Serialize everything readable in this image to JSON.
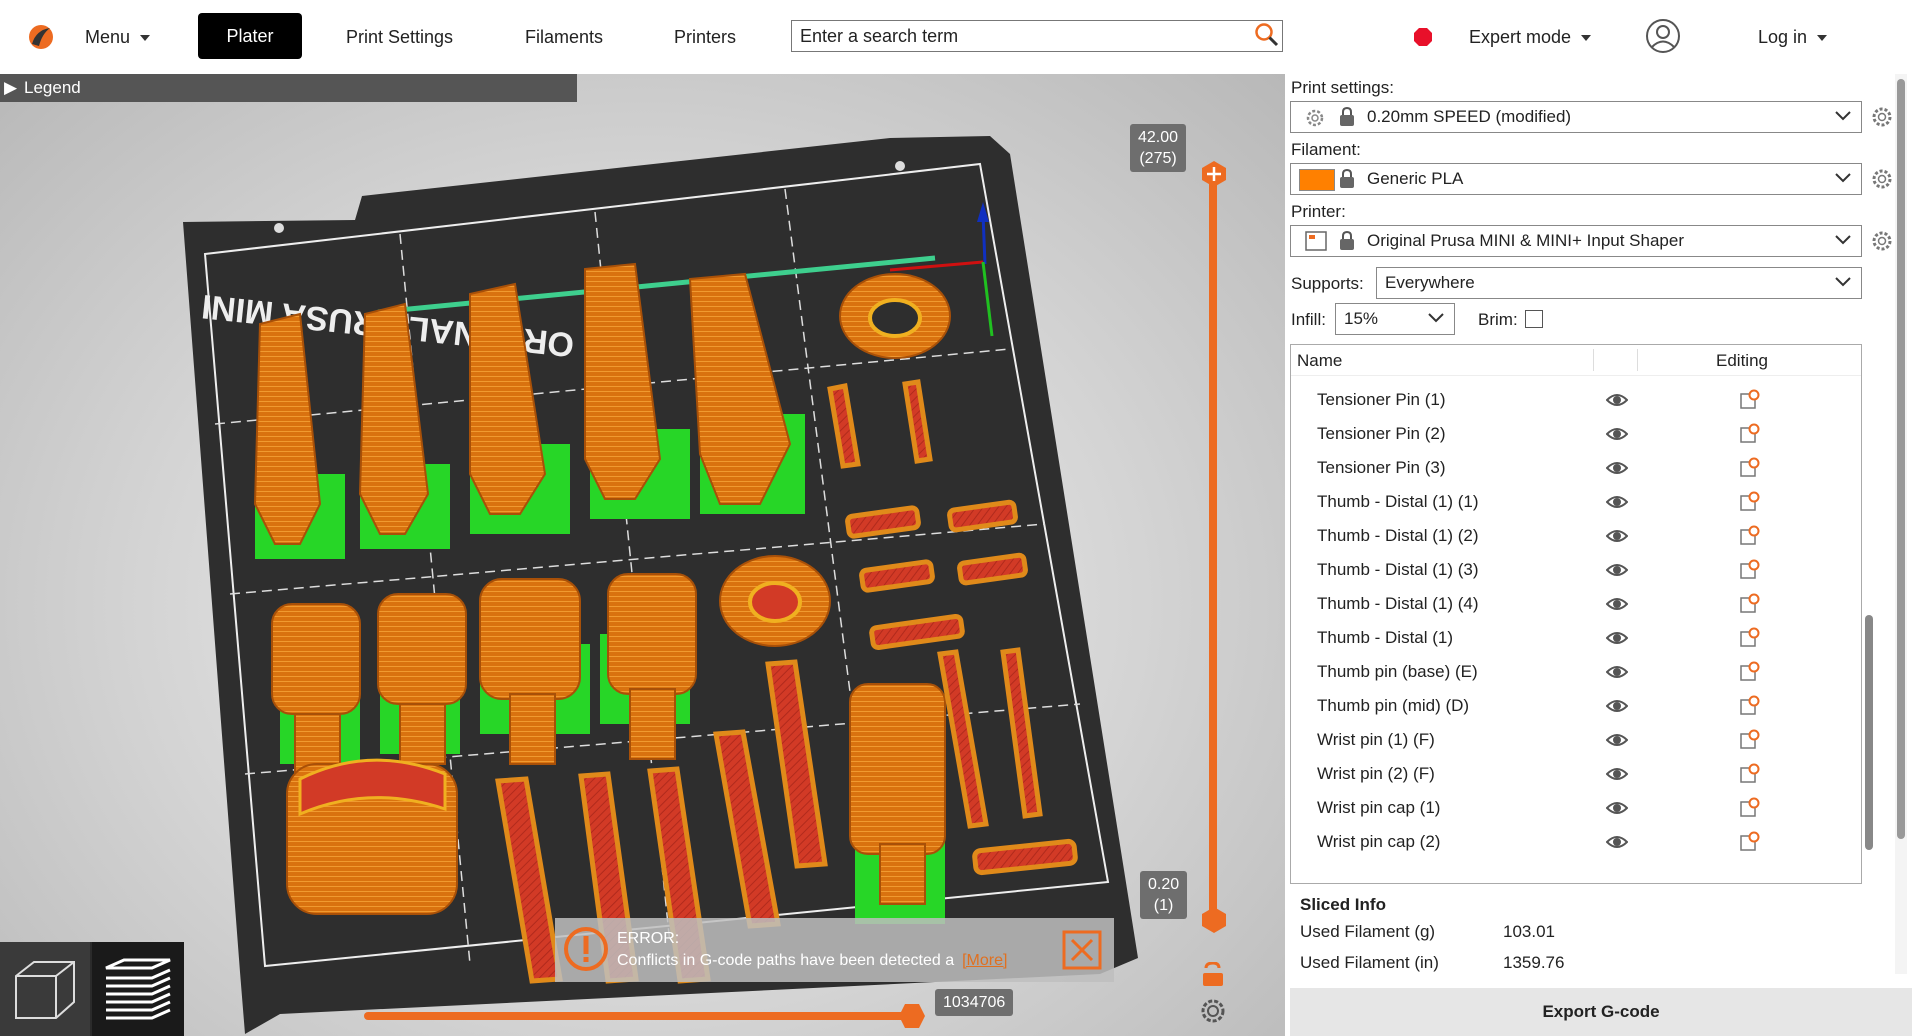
{
  "topbar": {
    "menu_label": "Menu",
    "tabs": [
      "Plater",
      "Print Settings",
      "Filaments",
      "Printers"
    ],
    "search_placeholder": "Enter a search term",
    "mode_label": "Expert mode",
    "login_label": "Log in"
  },
  "viewport": {
    "legend_label": "Legend",
    "layer_top": "42.00",
    "layer_top_index": "(275)",
    "layer_bottom": "0.20",
    "layer_bottom_index": "(1)",
    "move_value": "1034706",
    "bed_text": "ORIGINAL PRUSA MINI",
    "error_title": "ERROR:",
    "error_message": "Conflicts in G-code paths have been detected a",
    "error_more": "[More]"
  },
  "sidebar": {
    "print_settings_label": "Print settings:",
    "print_settings_value": "0.20mm SPEED (modified)",
    "filament_label": "Filament:",
    "filament_value": "Generic PLA",
    "filament_color": "#ff8000",
    "printer_label": "Printer:",
    "printer_value": "Original Prusa MINI & MINI+ Input Shaper",
    "supports_label": "Supports:",
    "supports_value": "Everywhere",
    "infill_label": "Infill:",
    "infill_value": "15%",
    "brim_label": "Brim:",
    "brim_checked": false,
    "list_header_name": "Name",
    "list_header_editing": "Editing",
    "objects": [
      "Tensioner Pin (1)",
      "Tensioner Pin (2)",
      "Tensioner Pin (3)",
      "Thumb - Distal (1) (1)",
      "Thumb - Distal (1) (2)",
      "Thumb - Distal (1) (3)",
      "Thumb - Distal (1) (4)",
      "Thumb - Distal (1)",
      "Thumb pin (base) (E)",
      "Thumb pin (mid) (D)",
      "Wrist pin (1) (F)",
      "Wrist pin (2) (F)",
      "Wrist pin cap (1)",
      "Wrist pin cap (2)"
    ],
    "sliced_info_title": "Sliced Info",
    "used_filament_g_label": "Used Filament (g)",
    "used_filament_g": "103.01",
    "used_filament_in_label": "Used Filament (in)",
    "used_filament_in": "1359.76",
    "export_label": "Export G-code"
  },
  "colors": {
    "accent": "#ed6b21",
    "error_dot": "#e8102a",
    "perimeter": "#e07a14",
    "infill": "#d0342c",
    "support": "#22d422",
    "bed": "#2e2e2e"
  }
}
